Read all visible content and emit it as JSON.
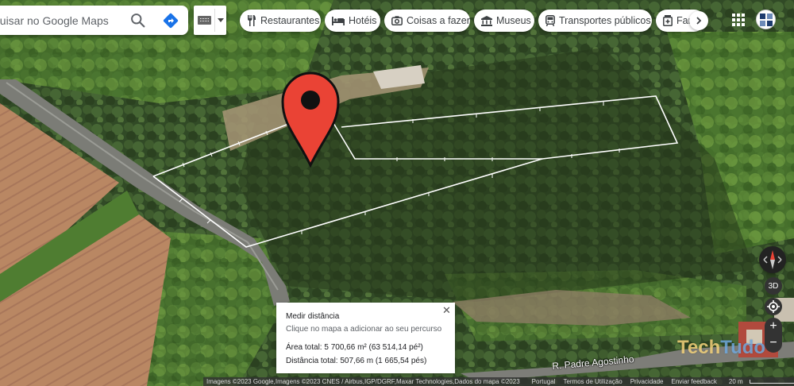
{
  "search": {
    "placeholder": "Pesquisar no Google Maps",
    "visible_text": "quisar no Google Maps",
    "search_icon": "search-icon",
    "directions_icon": "directions-icon"
  },
  "keyboard_toggle": {
    "icon": "keyboard-icon"
  },
  "chips": [
    {
      "label": "Restaurantes",
      "icon": "restaurant-icon"
    },
    {
      "label": "Hotéis",
      "icon": "hotel-icon"
    },
    {
      "label": "Coisas a fazer",
      "icon": "camera-icon"
    },
    {
      "label": "Museus",
      "icon": "museum-icon"
    },
    {
      "label": "Transportes públicos",
      "icon": "transit-icon"
    },
    {
      "label": "Far",
      "icon": "pharmacy-icon"
    }
  ],
  "chip_next_icon": "chevron-right-icon",
  "apps_icon": "apps-grid-icon",
  "map": {
    "road_label": "R. Padre Agostinho",
    "pin_color": "#ea4335"
  },
  "controls": {
    "compass_icon": "compass-icon",
    "btn_3d": "3D",
    "location_icon": "my-location-icon",
    "zoom_in": "+",
    "zoom_out": "−"
  },
  "measure": {
    "title": "Medir distância",
    "hint": "Clique no mapa a adicionar ao seu percurso",
    "area": "Área total: 5 700,66 m² (63 514,14 pé²)",
    "distance": "Distância total: 507,66 m (1 665,54 pés)",
    "close_icon": "close-icon"
  },
  "watermark": {
    "part1": "Tech",
    "part2": "Tudo"
  },
  "attribution": {
    "imagery": "Imagens ©2023 Google,Imagens ©2023 CNES / Airbus,IGP/DGRF,Maxar Technologies,Dados do mapa ©2023",
    "country": "Portugal",
    "terms": "Termos de Utilização",
    "privacy": "Privacidade",
    "feedback": "Enviar feedback",
    "scale": "20 m"
  }
}
